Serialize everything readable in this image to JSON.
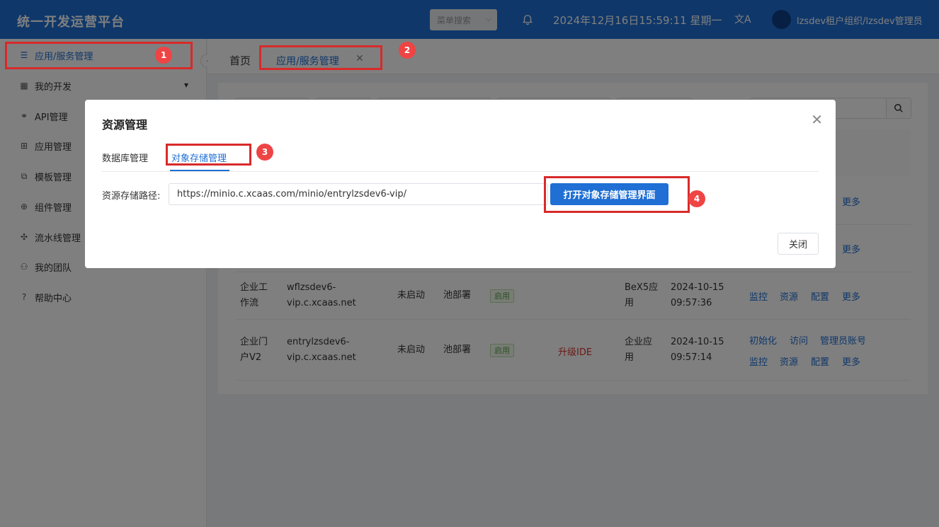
{
  "topbar": {
    "app_title": "统一开发运营平台",
    "menu_search_placeholder": "菜单搜索",
    "datetime": "2024年12月16日15:59:11 星期一",
    "user": "lzsdev租户组织/lzsdev管理员"
  },
  "sidebar": {
    "items": [
      {
        "label": "应用/服务管理",
        "icon": "list-icon"
      },
      {
        "label": "我的开发",
        "icon": "board-icon"
      },
      {
        "label": "API管理",
        "icon": "link-icon"
      },
      {
        "label": "应用管理",
        "icon": "grid-icon"
      },
      {
        "label": "模板管理",
        "icon": "copy-icon"
      },
      {
        "label": "组件管理",
        "icon": "component-icon"
      },
      {
        "label": "流水线管理",
        "icon": "pipeline-icon"
      },
      {
        "label": "我的团队",
        "icon": "team-icon"
      },
      {
        "label": "帮助中心",
        "icon": "help-icon"
      }
    ]
  },
  "tabs": {
    "home": "首页",
    "active": "应用/服务管理"
  },
  "table": {
    "rows": [
      {
        "name_l1": "企业工",
        "name_l2": "作流",
        "domain_l1": "wflzsdev6-",
        "domain_l2": "vip.c.xcaas.net",
        "status": "未启动",
        "pool": "池部署",
        "badge": "启用",
        "upgrade": "",
        "type_l1": "BeX5应",
        "type_l2": "用",
        "date_l1": "2024-10-15",
        "date_l2": "09:57:36"
      },
      {
        "name_l1": "企业门",
        "name_l2": "户V2",
        "domain_l1": "entrylzsdev6-",
        "domain_l2": "vip.c.xcaas.net",
        "status": "未启动",
        "pool": "池部署",
        "badge": "启用",
        "upgrade": "升级IDE",
        "type_l1": "企业应",
        "type_l2": "用",
        "date_l1": "2024-10-15",
        "date_l2": "09:57:14"
      }
    ],
    "actions": {
      "more": "更多",
      "monitor": "监控",
      "resource": "资源",
      "config": "配置",
      "init": "初始化",
      "visit": "访问",
      "admin_account": "管理员账号"
    }
  },
  "modal": {
    "title": "资源管理",
    "tab_db": "数据库管理",
    "tab_obj": "对象存储管理",
    "path_label": "资源存储路径:",
    "path_value": "https://minio.c.xcaas.com/minio/entrylzsdev6-vip/",
    "open_button": "打开对象存储管理界面",
    "close_button": "关闭"
  },
  "annotations": [
    "1",
    "2",
    "3",
    "4"
  ],
  "colors": {
    "primary": "#1f6fd4",
    "annotation": "#d82a2a",
    "badge_green": "#52a048",
    "upgrade_red": "#d9342b"
  }
}
